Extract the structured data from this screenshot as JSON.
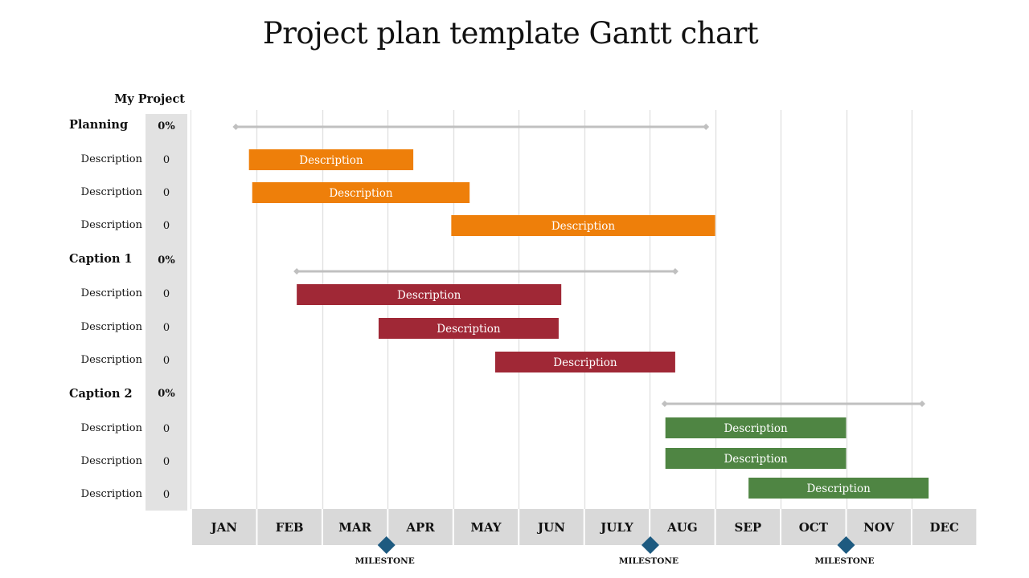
{
  "title": "Project plan template Gantt chart",
  "project_label": "My Project",
  "colors": {
    "planning": "#ee7f0a",
    "caption1": "#a02836",
    "caption2": "#4f8543",
    "summary_line": "#c0c0c0",
    "milestone": "#1d5a80",
    "month_cell": "#d9d9d9",
    "pct_column": "#e2e2e2",
    "gridline": "#e0e0e0"
  },
  "chart_data": {
    "type": "gantt",
    "title": "Project plan template Gantt chart",
    "x_unit": "months from start of JAN",
    "xlim": [
      0,
      12
    ],
    "categories": [
      "JAN",
      "FEB",
      "MAR",
      "APR",
      "MAY",
      "JUN",
      "JULY",
      "AUG",
      "SEP",
      "OCT",
      "NOV",
      "DEC"
    ],
    "grid": true,
    "groups": [
      {
        "name": "Planning",
        "percent": "0%",
        "color_key": "planning",
        "summary": {
          "start": 0.68,
          "end": 7.86
        },
        "tasks": [
          {
            "label": "Description",
            "value": "0",
            "bar_label": "Description",
            "start": 0.88,
            "end": 3.39
          },
          {
            "label": "Description",
            "value": "0",
            "bar_label": "Description",
            "start": 0.93,
            "end": 4.25
          },
          {
            "label": "Description",
            "value": "0",
            "bar_label": "Description",
            "start": 3.97,
            "end": 8.0
          }
        ]
      },
      {
        "name": "Caption 1",
        "percent": "0%",
        "color_key": "caption1",
        "summary": {
          "start": 1.61,
          "end": 7.39
        },
        "tasks": [
          {
            "label": "Description",
            "value": "0",
            "bar_label": "Description",
            "start": 1.61,
            "end": 5.65
          },
          {
            "label": "Description",
            "value": "0",
            "bar_label": "Description",
            "start": 2.86,
            "end": 5.61
          },
          {
            "label": "Description",
            "value": "0",
            "bar_label": "Description",
            "start": 4.64,
            "end": 7.39
          }
        ]
      },
      {
        "name": "Caption 2",
        "percent": "0%",
        "color_key": "caption2",
        "summary": {
          "start": 7.23,
          "end": 11.16
        },
        "tasks": [
          {
            "label": "Description",
            "value": "0",
            "bar_label": "Description",
            "start": 7.24,
            "end": 10.0
          },
          {
            "label": "Description",
            "value": "0",
            "bar_label": "Description",
            "start": 7.24,
            "end": 10.0
          },
          {
            "label": "Description",
            "value": "0",
            "bar_label": "Description",
            "start": 8.51,
            "end": 11.26
          }
        ]
      }
    ],
    "milestones": [
      {
        "label": "MILESTONE",
        "at": 2.98
      },
      {
        "label": "MILESTONE",
        "at": 7.01
      },
      {
        "label": "MILESTONE",
        "at": 10.0
      }
    ]
  }
}
